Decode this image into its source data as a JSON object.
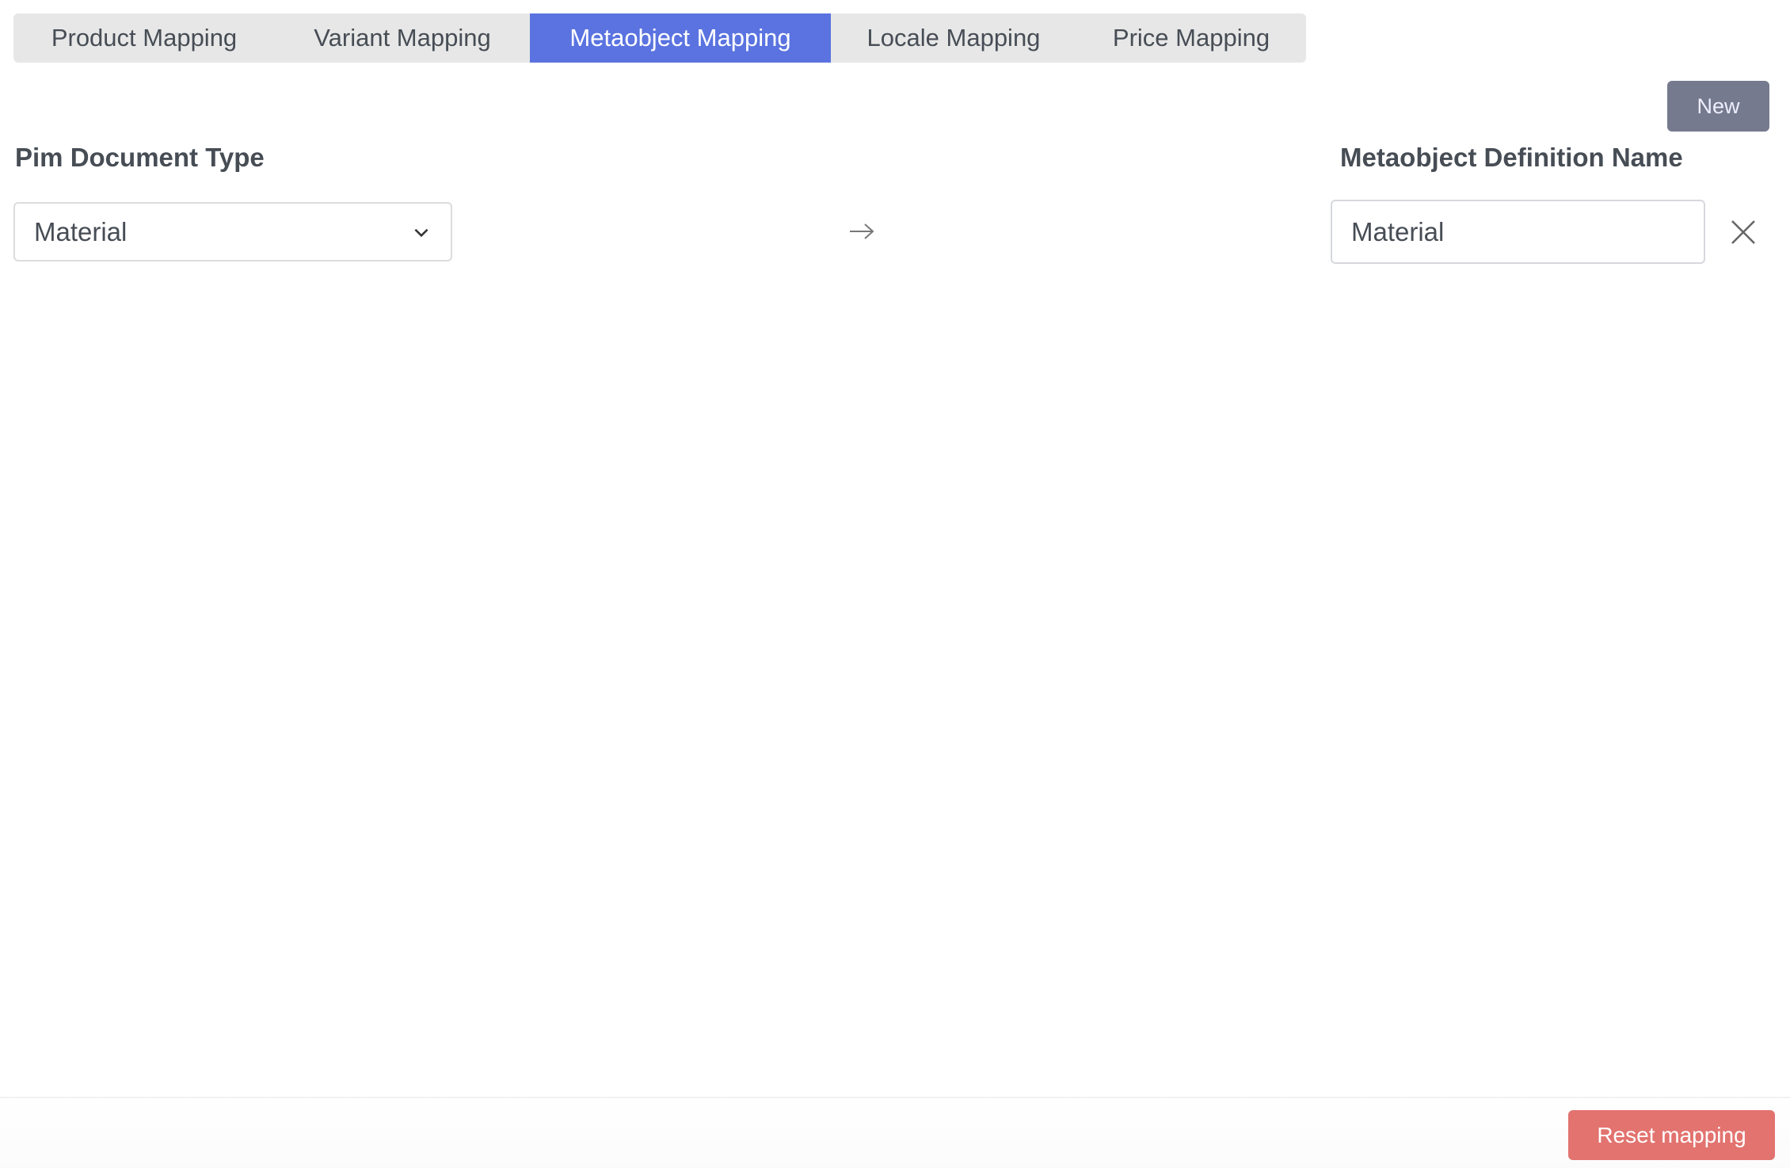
{
  "tabs": [
    {
      "label": "Product Mapping",
      "active": false
    },
    {
      "label": "Variant Mapping",
      "active": false
    },
    {
      "label": "Metaobject Mapping",
      "active": true
    },
    {
      "label": "Locale Mapping",
      "active": false
    },
    {
      "label": "Price Mapping",
      "active": false
    }
  ],
  "colors": {
    "active_tab": "#5a73e0",
    "new_button": "#767a8e",
    "reset_button": "#e2736f"
  },
  "toolbar": {
    "new_label": "New"
  },
  "mapping": {
    "left_label": "Pim Document Type",
    "left_value": "Material",
    "right_label": "Metaobject Definition Name",
    "right_value": "Material"
  },
  "footer": {
    "reset_label": "Reset mapping"
  }
}
